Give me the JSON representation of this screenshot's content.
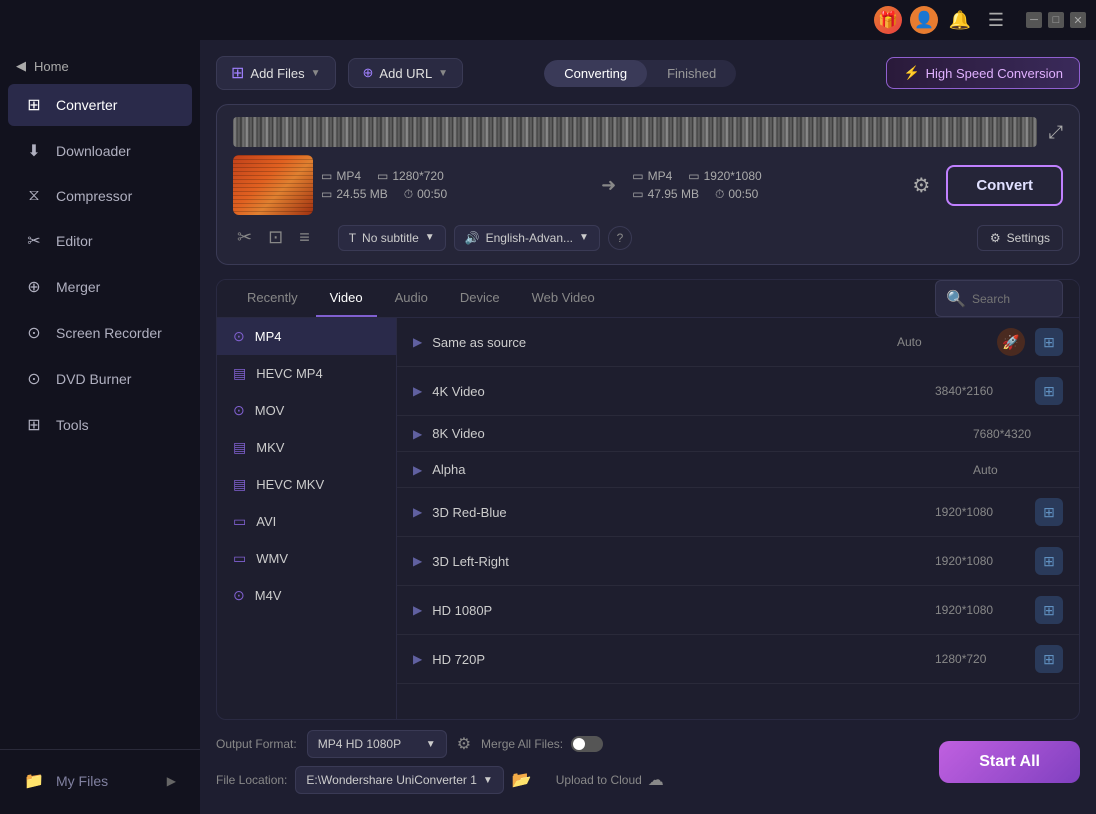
{
  "titlebar": {
    "controls": [
      "minimize",
      "maximize",
      "close"
    ]
  },
  "sidebar": {
    "collapse_label": "Home",
    "items": [
      {
        "id": "converter",
        "label": "Converter",
        "icon": "⊞",
        "active": true
      },
      {
        "id": "downloader",
        "label": "Downloader",
        "icon": "⬇"
      },
      {
        "id": "compressor",
        "label": "Compressor",
        "icon": "⧖"
      },
      {
        "id": "editor",
        "label": "Editor",
        "icon": "✂"
      },
      {
        "id": "merger",
        "label": "Merger",
        "icon": "⊕"
      },
      {
        "id": "screen-recorder",
        "label": "Screen Recorder",
        "icon": "⊙"
      },
      {
        "id": "dvd-burner",
        "label": "DVD Burner",
        "icon": "⊙"
      },
      {
        "id": "tools",
        "label": "Tools",
        "icon": "⊞"
      }
    ],
    "bottom": {
      "label": "My Files",
      "icon": "📁"
    }
  },
  "toolbar": {
    "add_file_label": "Add Files",
    "add_url_label": "Add URL",
    "tab_converting": "Converting",
    "tab_finished": "Finished",
    "speed_label": "High Speed Conversion"
  },
  "file": {
    "source_format": "MP4",
    "source_resolution": "1280*720",
    "source_size": "24.55 MB",
    "source_duration": "00:50",
    "target_format": "MP4",
    "target_resolution": "1920*1080",
    "target_size": "47.95 MB",
    "target_duration": "00:50",
    "convert_label": "Convert",
    "subtitle_label": "No subtitle",
    "audio_label": "English-Advan...",
    "settings_label": "Settings"
  },
  "format_panel": {
    "tabs": [
      {
        "id": "recently",
        "label": "Recently"
      },
      {
        "id": "video",
        "label": "Video",
        "active": true
      },
      {
        "id": "audio",
        "label": "Audio"
      },
      {
        "id": "device",
        "label": "Device"
      },
      {
        "id": "web-video",
        "label": "Web Video"
      }
    ],
    "search_placeholder": "Search",
    "formats": [
      {
        "id": "mp4",
        "label": "MP4",
        "icon": "⊙",
        "active": true
      },
      {
        "id": "hevc-mp4",
        "label": "HEVC MP4",
        "icon": "▤"
      },
      {
        "id": "mov",
        "label": "MOV",
        "icon": "⊙"
      },
      {
        "id": "mkv",
        "label": "MKV",
        "icon": "▤"
      },
      {
        "id": "hevc-mkv",
        "label": "HEVC MKV",
        "icon": "▤"
      },
      {
        "id": "avi",
        "label": "AVI",
        "icon": "▭"
      },
      {
        "id": "wmv",
        "label": "WMV",
        "icon": "▭"
      },
      {
        "id": "m4v",
        "label": "M4V",
        "icon": "⊙"
      }
    ],
    "qualities": [
      {
        "id": "same-as-source",
        "label": "Same as source",
        "res": "Auto",
        "has_rocket": true,
        "has_action": true
      },
      {
        "id": "4k-video",
        "label": "4K Video",
        "res": "3840*2160",
        "has_action": true
      },
      {
        "id": "8k-video",
        "label": "8K Video",
        "res": "7680*4320",
        "has_action": false
      },
      {
        "id": "alpha",
        "label": "Alpha",
        "res": "Auto",
        "has_action": false
      },
      {
        "id": "3d-red-blue",
        "label": "3D Red-Blue",
        "res": "1920*1080",
        "has_action": true
      },
      {
        "id": "3d-left-right",
        "label": "3D Left-Right",
        "res": "1920*1080",
        "has_action": true
      },
      {
        "id": "hd-1080p",
        "label": "HD 1080P",
        "res": "1920*1080",
        "has_action": true
      },
      {
        "id": "hd-720p",
        "label": "HD 720P",
        "res": "1280*720",
        "has_action": true
      }
    ]
  },
  "bottom_bar": {
    "output_format_label": "Output Format:",
    "output_format_value": "MP4 HD 1080P",
    "merge_label": "Merge All Files:",
    "merge_on": false,
    "file_location_label": "File Location:",
    "file_location_value": "E:\\Wondershare UniConverter 1",
    "start_all_label": "Start All",
    "upload_label": "Upload to Cloud"
  }
}
